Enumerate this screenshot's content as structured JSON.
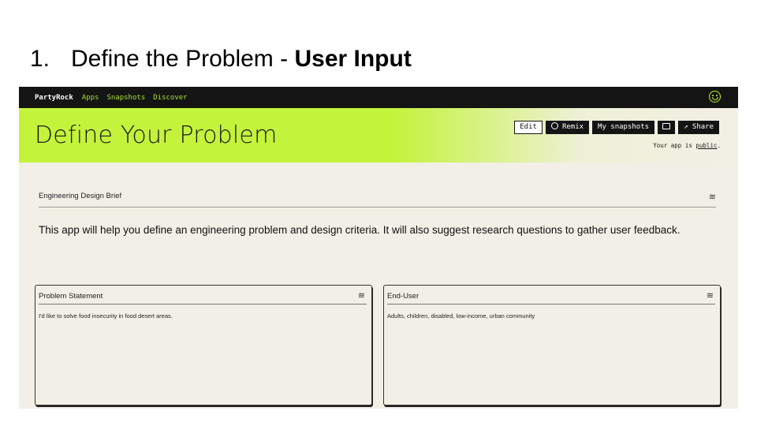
{
  "slide": {
    "number": "1.",
    "title_plain": "Define the Problem - ",
    "title_bold": "User Input"
  },
  "app": {
    "brand": "PartyRock",
    "nav": [
      "Apps",
      "Snapshots",
      "Discover"
    ],
    "title": "Define Your Problem",
    "buttons": {
      "edit": "Edit",
      "remix": "Remix",
      "snapshots": "My snapshots",
      "share": "Share"
    },
    "visibility_prefix": "Your app is ",
    "visibility_link": "public",
    "visibility_suffix": ".",
    "brief_title": "Engineering Design Brief",
    "description": "This app will help you define an engineering problem and design criteria. It will also suggest research questions to gather user feedback.",
    "cards": [
      {
        "title": "Problem Statement",
        "content": "I'd like to solve food insecurity in food desert areas."
      },
      {
        "title": "End-User",
        "content": "Adults, children, disabled, low-income, urban community"
      }
    ],
    "colors": {
      "accent": "#c4f33c",
      "background": "#f2efe6",
      "topbar": "#141414",
      "nav": "#a6e22e"
    },
    "icons": [
      "smiley-icon",
      "remix-icon",
      "camera-icon",
      "share-arrow-icon",
      "sliders-icon"
    ]
  }
}
